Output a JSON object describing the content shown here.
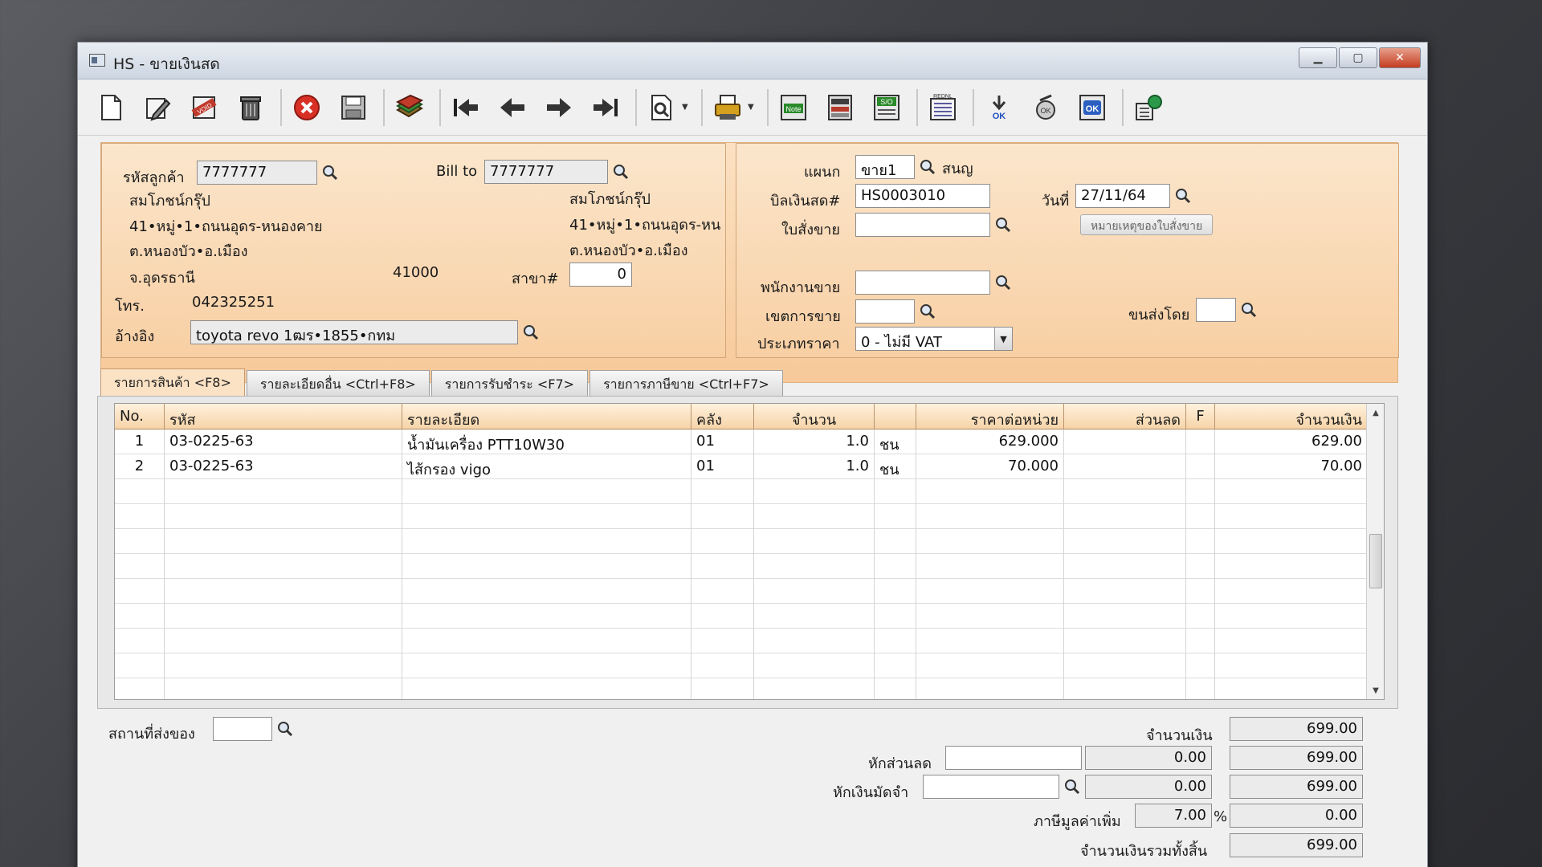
{
  "window": {
    "title": "HS - ขายเงินสด"
  },
  "toolbar": {
    "buttons": [
      "new-icon",
      "edit-icon",
      "void-icon",
      "delete-icon",
      "cancel-icon",
      "save-icon",
      "copy-icon",
      "first-icon",
      "prev-icon",
      "next-icon",
      "last-icon",
      "preview-icon",
      "print-icon",
      "note-icon",
      "calc-icon",
      "so-icon",
      "report-icon",
      "approve-icon",
      "check-icon",
      "ok-icon",
      "transfer-icon"
    ],
    "notes": {
      "note": "Note",
      "so": "S/O",
      "ok": "OK",
      "approve": "OK",
      "report": "REDNL"
    }
  },
  "customer": {
    "code_label": "รหัสลูกค้า",
    "code": "7777777",
    "name": "สมโภชน์กรุ๊ป",
    "addr1": "41•หมู่•1•ถนนอุดร-หนองคาย",
    "addr2": "ต.หนองบัว•อ.เมือง",
    "addr3": "จ.อุดรธานี",
    "zip": "41000",
    "phone_label": "โทร.",
    "phone": "042325251",
    "ref_label": "อ้างอิง",
    "ref": "toyota revo 1ฒร•1855•กทม"
  },
  "billto": {
    "label": "Bill to",
    "code": "7777777",
    "name": "สมโภชน์กรุ๊ป",
    "addr1": "41•หมู่•1•ถนนอุดร-หน",
    "addr2": "ต.หนองบัว•อ.เมือง",
    "branch_label": "สาขา#",
    "branch": "0"
  },
  "doc": {
    "dept_label": "แผนก",
    "dept": "ขาย1",
    "dept_name": "สนญ",
    "bill_label": "บิลเงินสด#",
    "bill_no": "HS0003010",
    "order_label": "ใบสั่งขาย",
    "order_no": "",
    "date_label": "วันที่",
    "date": "27/11/64",
    "order_note_button": "หมายเหตุของใบสั่งขาย",
    "salesman_label": "พนักงานขาย",
    "salesman": "",
    "area_label": "เขตการขาย",
    "area": "",
    "ship_label": "ขนส่งโดย",
    "ship": "",
    "price_type_label": "ประเภทราคา",
    "price_type": "0 - ไม่มี VAT"
  },
  "tabs": [
    {
      "label": "รายการสินค้า <F8>",
      "active": true
    },
    {
      "label": "รายละเอียดอื่น <Ctrl+F8>",
      "active": false
    },
    {
      "label": "รายการรับชำระ <F7>",
      "active": false
    },
    {
      "label": "รายการภาษีขาย <Ctrl+F7>",
      "active": false
    }
  ],
  "grid": {
    "headers": [
      "No.",
      "รหัส",
      "รายละเอียด",
      "คลัง",
      "จำนวน",
      "",
      "ราคาต่อหน่วย",
      "ส่วนลด",
      "F",
      "จำนวนเงิน"
    ],
    "rows": [
      {
        "no": "1",
        "code": "03-0225-63",
        "desc": "น้ำมันเครื่อง PTT10W30",
        "wh": "01",
        "qty": "1.0",
        "unit": "ชน",
        "price": "629.000",
        "disc": "",
        "f": "",
        "amount": "629.00"
      },
      {
        "no": "2",
        "code": "03-0225-63",
        "desc": "ไส้กรอง vigo",
        "wh": "01",
        "qty": "1.0",
        "unit": "ชน",
        "price": "70.000",
        "disc": "",
        "f": "",
        "amount": "70.00"
      }
    ]
  },
  "footer": {
    "ship_place_label": "สถานที่ส่งของ",
    "ship_place": "",
    "amount_label": "จำนวนเงิน",
    "amount": "699.00",
    "discount_label": "หักส่วนลด",
    "discount_text": "",
    "discount_value": "0.00",
    "after_discount": "699.00",
    "deposit_label": "หักเงินมัดจำ",
    "deposit_text": "",
    "deposit_value": "0.00",
    "after_deposit": "699.00",
    "vat_label": "ภาษีมูลค่าเพิ่ม",
    "vat_rate": "7.00",
    "vat_percent": "%",
    "vat_amount": "0.00",
    "total_label": "จำนวนเงินรวมทั้งสิ้น",
    "total": "699.00"
  }
}
